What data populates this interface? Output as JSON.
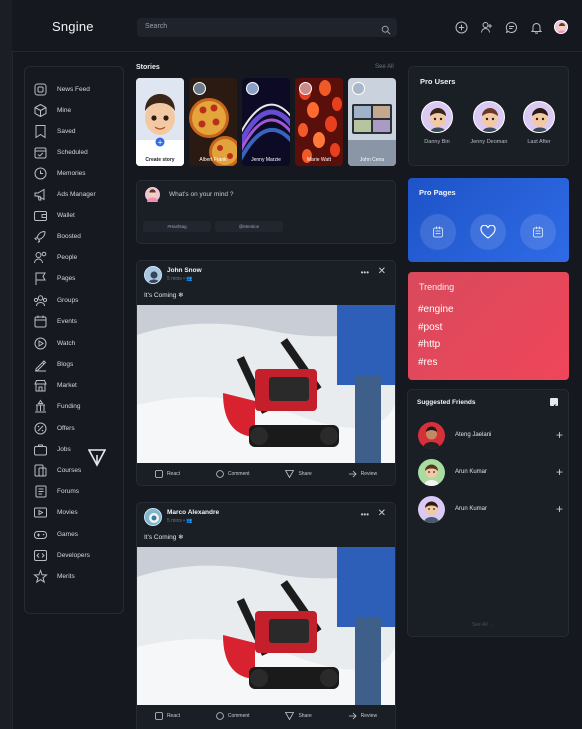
{
  "app": {
    "title": "Sngine"
  },
  "search": {
    "placeholder": "Search"
  },
  "nav": [
    {
      "label": "News Feed",
      "icon": "news-feed-icon"
    },
    {
      "label": "Mine",
      "icon": "cube-icon"
    },
    {
      "label": "Saved",
      "icon": "bookmark-icon"
    },
    {
      "label": "Scheduled",
      "icon": "calendar-check-icon"
    },
    {
      "label": "Memories",
      "icon": "memories-icon"
    },
    {
      "label": "Ads Manager",
      "icon": "megaphone-icon"
    },
    {
      "label": "Wallet",
      "icon": "wallet-icon"
    },
    {
      "label": "Boosted",
      "icon": "rocket-icon"
    },
    {
      "label": "People",
      "icon": "people-icon"
    },
    {
      "label": "Pages",
      "icon": "flag-icon"
    },
    {
      "label": "Groups",
      "icon": "groups-icon"
    },
    {
      "label": "Events",
      "icon": "calendar-icon"
    },
    {
      "label": "Watch",
      "icon": "play-icon"
    },
    {
      "label": "Blogs",
      "icon": "blog-icon"
    },
    {
      "label": "Market",
      "icon": "store-icon"
    },
    {
      "label": "Funding",
      "icon": "funding-icon"
    },
    {
      "label": "Offers",
      "icon": "offers-icon"
    },
    {
      "label": "Jobs",
      "icon": "briefcase-icon"
    },
    {
      "label": "Courses",
      "icon": "courses-icon"
    },
    {
      "label": "Forums",
      "icon": "forums-icon"
    },
    {
      "label": "Movies",
      "icon": "film-icon"
    },
    {
      "label": "Games",
      "icon": "gamepad-icon"
    },
    {
      "label": "Developers",
      "icon": "code-icon"
    },
    {
      "label": "Merits",
      "icon": "star-icon"
    }
  ],
  "stories": {
    "title": "Stories",
    "see_all": "See All",
    "items": [
      {
        "name": "Create story"
      },
      {
        "name": "Albert Frank"
      },
      {
        "name": "Jenny Marzie"
      },
      {
        "name": "Marie Watt"
      },
      {
        "name": "John Cena"
      }
    ]
  },
  "composer": {
    "placeholder": "What's on your mind ?",
    "chip1": "#Hashtag",
    "chip2": "@Mention"
  },
  "posts": [
    {
      "author": "John Snow",
      "time": "5 mins •",
      "text": "It's Coming ❄",
      "actions": {
        "react": "React",
        "comment": "Comment",
        "share": "Share",
        "review": "Review"
      }
    },
    {
      "author": "Marco Alexandre",
      "time": "5 mins •",
      "text": "It's Coming ❄",
      "actions": {
        "react": "React",
        "comment": "Comment",
        "share": "Share",
        "review": "Review"
      }
    }
  ],
  "pro_users": {
    "title": "Pro Users",
    "users": [
      {
        "name": "Danny Bin"
      },
      {
        "name": "Jenny Deoman"
      },
      {
        "name": "Last After"
      }
    ]
  },
  "pro_pages": {
    "title": "Pro Pages"
  },
  "trending": {
    "title": "Trending",
    "tags": [
      "#engine",
      "#post",
      "#http",
      "#res"
    ]
  },
  "suggested": {
    "title": "Suggested Friends",
    "see_all": "See All",
    "friends": [
      {
        "name": "Ateng Jaelani"
      },
      {
        "name": "Arun Kumar"
      },
      {
        "name": "Arun Kumar"
      }
    ]
  },
  "colors": {
    "background": "#15191f",
    "pro_pages": "#2f6be6",
    "trending": "#f0455a"
  }
}
